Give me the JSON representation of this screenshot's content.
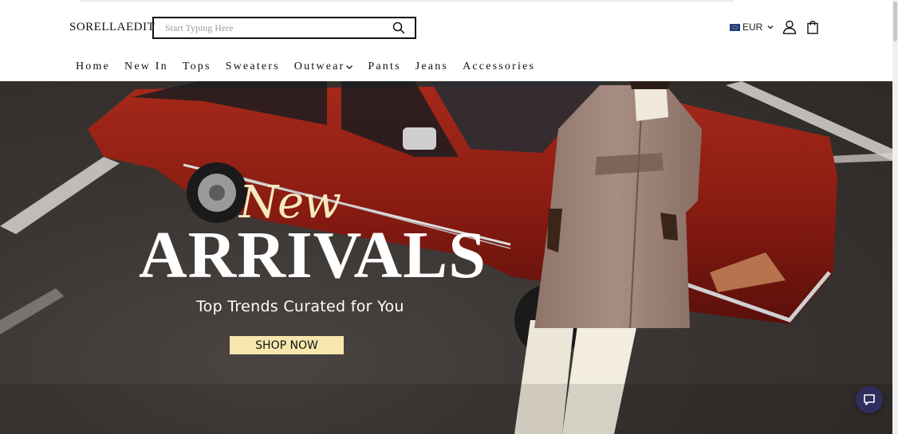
{
  "brand": {
    "logo_text": "SORELLAEDIT"
  },
  "search": {
    "placeholder": "Start Typing Here",
    "value": "",
    "icon": "search-icon"
  },
  "currency": {
    "code": "EUR",
    "flag": "eu-flag-icon"
  },
  "header_icons": {
    "account": "user-icon",
    "cart": "shopping-bag-icon"
  },
  "nav": {
    "items": [
      {
        "label": "Home"
      },
      {
        "label": "New In"
      },
      {
        "label": "Tops"
      },
      {
        "label": "Sweaters"
      },
      {
        "label": "Outwear",
        "has_dropdown": true
      },
      {
        "label": "Pants"
      },
      {
        "label": "Jeans"
      },
      {
        "label": "Accessories"
      }
    ]
  },
  "hero": {
    "headline_script": "New",
    "headline_main": "ARRIVALS",
    "subtitle": "Top Trends Curated for You",
    "cta_label": "SHOP NOW"
  },
  "chat": {
    "icon": "chat-bubble-icon"
  },
  "colors": {
    "cta_background": "#f7e7ad",
    "script_text": "#f5e9c2",
    "chat_button": "#2f2e5e",
    "car_red": "#8a1c12"
  }
}
